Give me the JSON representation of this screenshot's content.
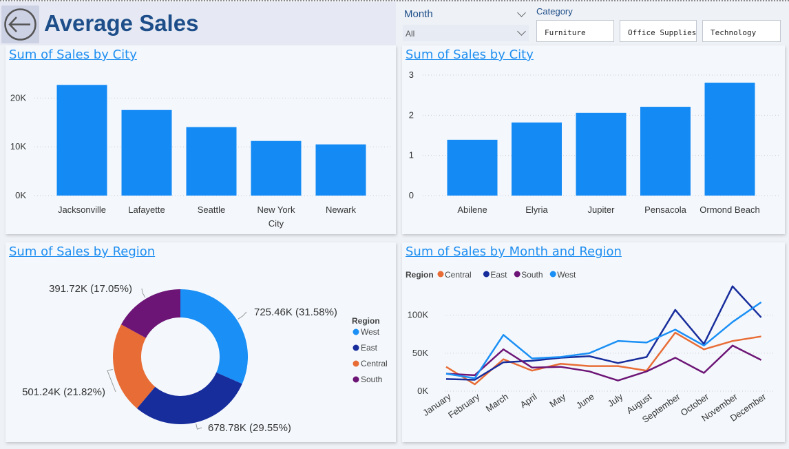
{
  "header": {
    "title": "Average Sales",
    "back_icon": "back-arrow-icon"
  },
  "filters": {
    "month": {
      "label": "Month",
      "value": "All"
    },
    "category": {
      "label": "Category",
      "options": [
        "Furniture",
        "Office Supplies",
        "Technology"
      ]
    }
  },
  "colors": {
    "bar": "#148af5",
    "west": "#1a8ff5",
    "east": "#182d9c",
    "central": "#e86c35",
    "south": "#6d1576"
  },
  "chart_data": [
    {
      "type": "bar",
      "title": "Sum of Sales by City",
      "categories": [
        "Jacksonville",
        "Lafayette",
        "Seattle",
        "New York City",
        "Newark"
      ],
      "values": [
        22700,
        17550,
        14050,
        11200,
        10500
      ],
      "ylim": [
        0,
        25000
      ],
      "yticks": [
        0,
        10000,
        20000
      ],
      "ytick_labels": [
        "0K",
        "10K",
        "20K"
      ],
      "grid": true
    },
    {
      "type": "bar",
      "title": "Sum of Sales by City",
      "categories": [
        "Abilene",
        "Elyria",
        "Jupiter",
        "Pensacola",
        "Ormond Beach"
      ],
      "values": [
        1.39,
        1.82,
        2.06,
        2.21,
        2.81
      ],
      "ylim": [
        0,
        3
      ],
      "yticks": [
        0,
        1,
        2,
        3
      ],
      "ytick_labels": [
        "0",
        "1",
        "2",
        "3"
      ],
      "grid": true
    },
    {
      "type": "pie",
      "donut": true,
      "title": "Sum of Sales by Region",
      "legend_title": "Region",
      "legend_position": "right",
      "categories": [
        "West",
        "East",
        "Central",
        "South"
      ],
      "values": [
        725.46,
        678.78,
        501.24,
        391.72
      ],
      "data_labels": [
        "725.46K (31.58%)",
        "678.78K (29.55%)",
        "501.24K (21.82%)",
        "391.72K (17.05%)"
      ]
    },
    {
      "type": "line",
      "title": "Sum of Sales by Month and Region",
      "legend_title": "Region",
      "legend_position": "top-left",
      "x": [
        "January",
        "February",
        "March",
        "April",
        "May",
        "June",
        "July",
        "August",
        "September",
        "October",
        "November",
        "December"
      ],
      "ylim": [
        0,
        145000
      ],
      "yticks": [
        0,
        50000,
        100000
      ],
      "ytick_labels": [
        "0K",
        "50K",
        "100K"
      ],
      "grid": true,
      "series": [
        {
          "name": "Central",
          "values": [
            32000,
            9000,
            42000,
            27000,
            36000,
            33000,
            33000,
            27000,
            77000,
            55000,
            66000,
            72000
          ]
        },
        {
          "name": "East",
          "values": [
            16000,
            15000,
            38000,
            40000,
            44000,
            46000,
            37000,
            45000,
            107000,
            62000,
            138000,
            97000
          ]
        },
        {
          "name": "South",
          "values": [
            23000,
            21000,
            55000,
            31000,
            32000,
            26000,
            14000,
            26000,
            44000,
            24000,
            60000,
            41000
          ]
        },
        {
          "name": "West",
          "values": [
            23000,
            17000,
            74000,
            43000,
            45000,
            50000,
            66000,
            64000,
            81000,
            60000,
            91000,
            117000
          ]
        }
      ]
    }
  ]
}
